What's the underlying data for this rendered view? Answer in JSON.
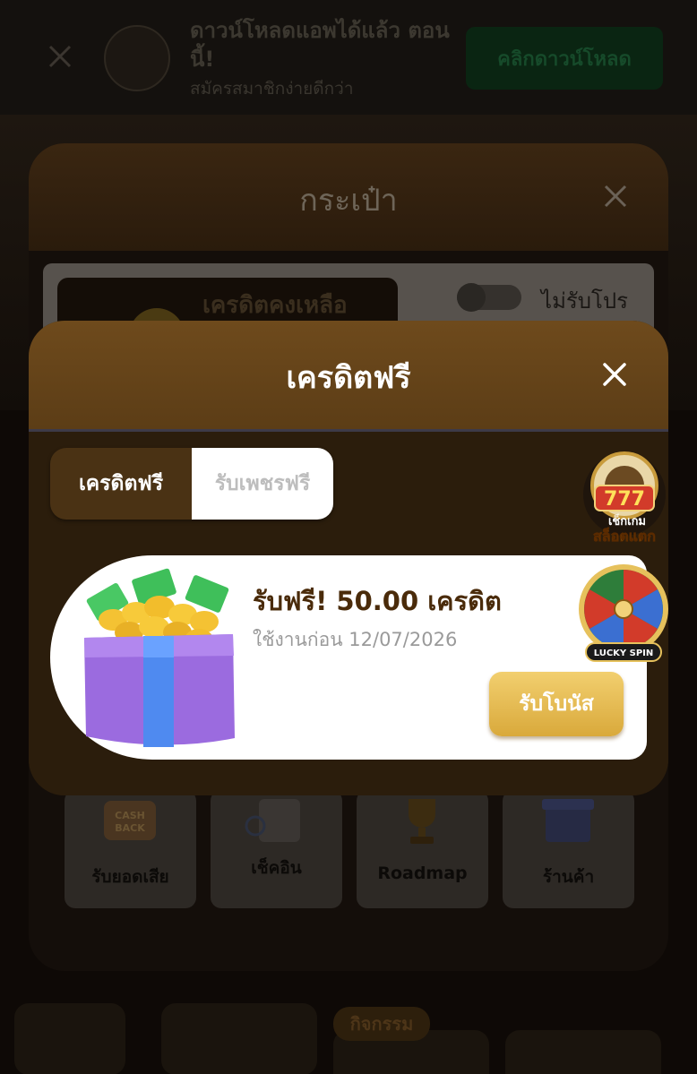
{
  "banner": {
    "title": "ดาวน์โหลดแอพได้แล้ว ตอนนี้!",
    "subtitle": "สมัครสมาชิกง่ายดีกว่า",
    "download_label": "คลิกดาวน์โหลด"
  },
  "wallet": {
    "title": "กระเป๋า",
    "credit_label": "เครดิตคงเหลือ",
    "promo_label": "ไม่รับโปร"
  },
  "grid": [
    {
      "label": "รับยอดเสีย",
      "icon": "cashback-icon",
      "icon_text": "CASH BACK"
    },
    {
      "label": "เช็คอิน",
      "icon": "calendar-icon"
    },
    {
      "label": "Roadmap",
      "icon": "trophy-icon"
    },
    {
      "label": "ร้านค้า",
      "icon": "shop-icon"
    }
  ],
  "bottom": {
    "activity_tag": "กิจกรรม"
  },
  "free_credit_modal": {
    "title": "เครดิตฟรี",
    "tabs": [
      {
        "label": "เครดิตฟรี",
        "active": true
      },
      {
        "label": "รับเพชรฟรี",
        "active": false
      }
    ],
    "reward": {
      "title": "รับฟรี! 50.00 เครดิต",
      "expiry": "ใช้งานก่อน 12/07/2026",
      "claim_label": "รับโบนัส"
    }
  },
  "floating_badges": {
    "slot": {
      "line1": "777",
      "line2": "เช็กเกม",
      "line3": "สล็อตแตก"
    },
    "spin": {
      "label": "LUCKY SPIN"
    }
  },
  "colors": {
    "accent_gold": "#d9a93b",
    "modal_brown": "#2b1d0c",
    "header_brown": "#6e4a1c",
    "reward_title": "#4a2b0a"
  }
}
